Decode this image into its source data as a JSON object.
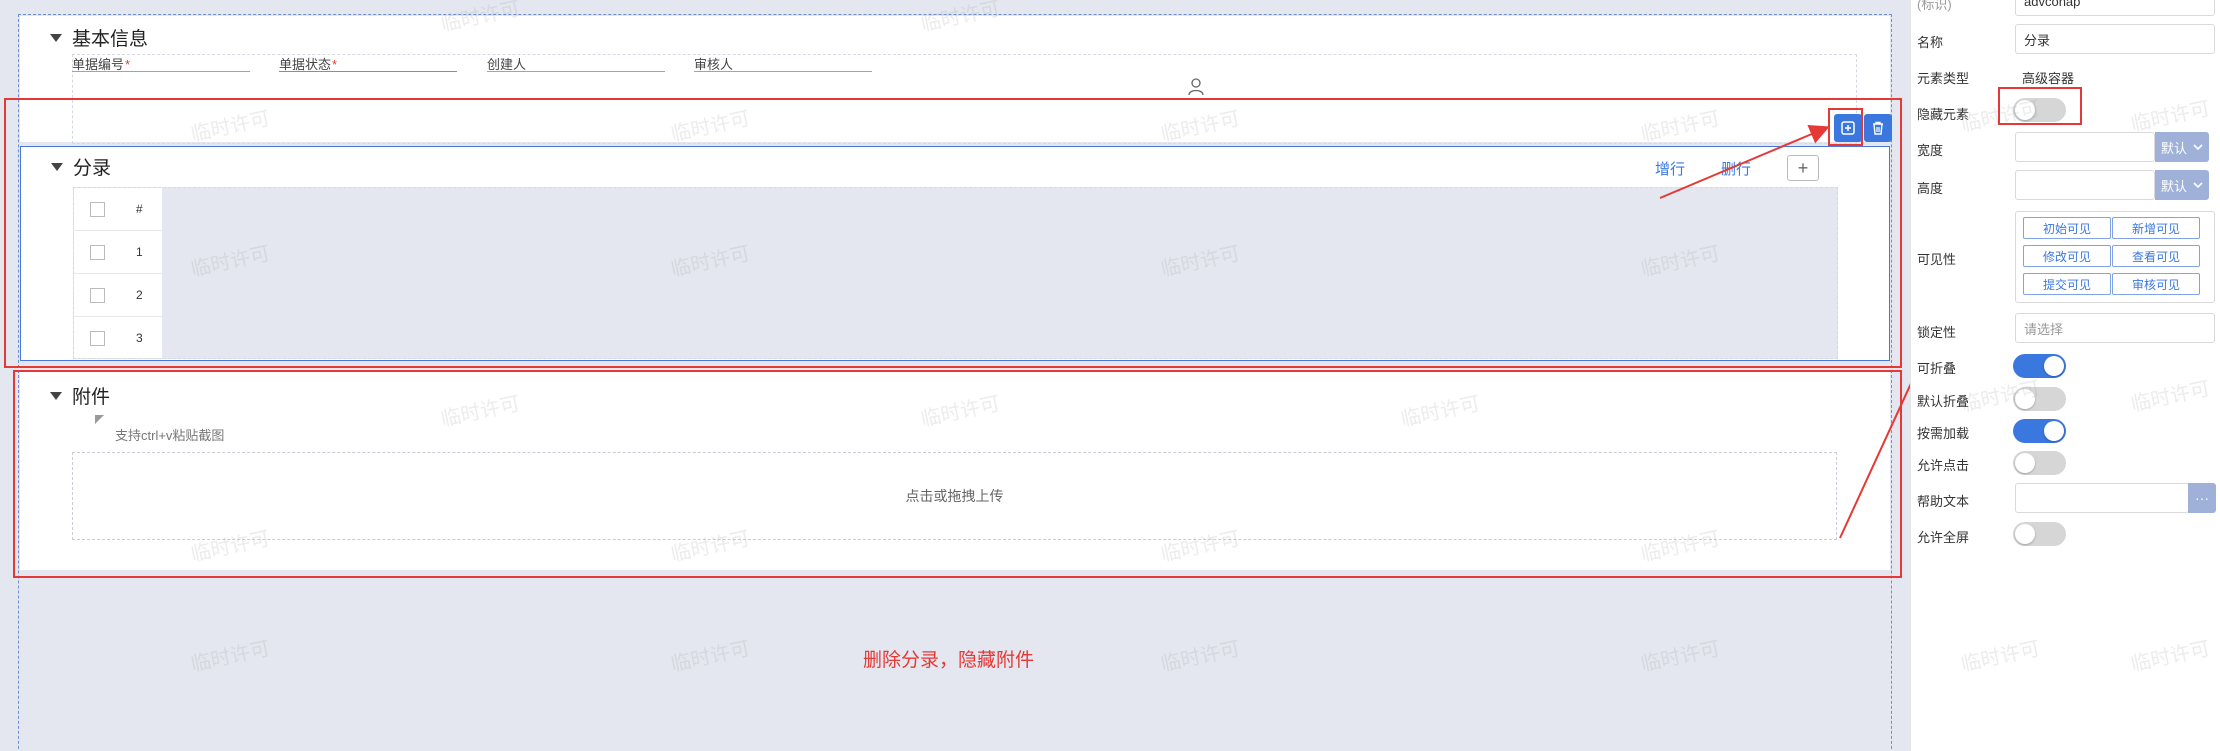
{
  "sections": {
    "basic": {
      "title": "基本信息",
      "fields": [
        {
          "label": "单据编号",
          "required": "*"
        },
        {
          "label": "单据状态",
          "required": "*"
        },
        {
          "label": "创建人",
          "required": ""
        },
        {
          "label": "审核人",
          "required": ""
        }
      ]
    },
    "entry": {
      "title": "分录",
      "add_row": "增行",
      "delete_row": "删行",
      "plus": "+",
      "grid": {
        "header_num": "#",
        "rows": [
          "1",
          "2",
          "3"
        ]
      }
    },
    "attach": {
      "title": "附件",
      "paste_hint": "支持ctrl+v粘贴截图",
      "upload_text": "点击或拖拽上传"
    }
  },
  "annotation": "删除分录，隐藏附件",
  "watermark": "临时许可",
  "panel": {
    "top_label": "(标识)",
    "top_value": "advconap",
    "name_label": "名称",
    "name_value": "分录",
    "type_label": "元素类型",
    "type_value": "高级容器",
    "hidden_label": "隐藏元素",
    "width_label": "宽度",
    "width_select": "默认",
    "height_label": "高度",
    "height_select": "默认",
    "visibility_label": "可见性",
    "visibility_buttons": [
      "初始可见",
      "新增可见",
      "修改可见",
      "查看可见",
      "提交可见",
      "审核可见"
    ],
    "lock_label": "锁定性",
    "lock_placeholder": "请选择",
    "collapsible_label": "可折叠",
    "default_collapse_label": "默认折叠",
    "lazy_load_label": "按需加载",
    "allow_click_label": "允许点击",
    "help_text_label": "帮助文本",
    "help_text_btn": "···",
    "allow_fullscreen_label": "允许全屏"
  },
  "toggles": {
    "hidden": false,
    "collapsible": true,
    "default_collapse": false,
    "lazy_load": true,
    "allow_click": false,
    "allow_fullscreen": false
  },
  "colors": {
    "accent": "#3a78e0",
    "annotation": "#e53935",
    "canvas_bg": "#e4e7ef"
  }
}
